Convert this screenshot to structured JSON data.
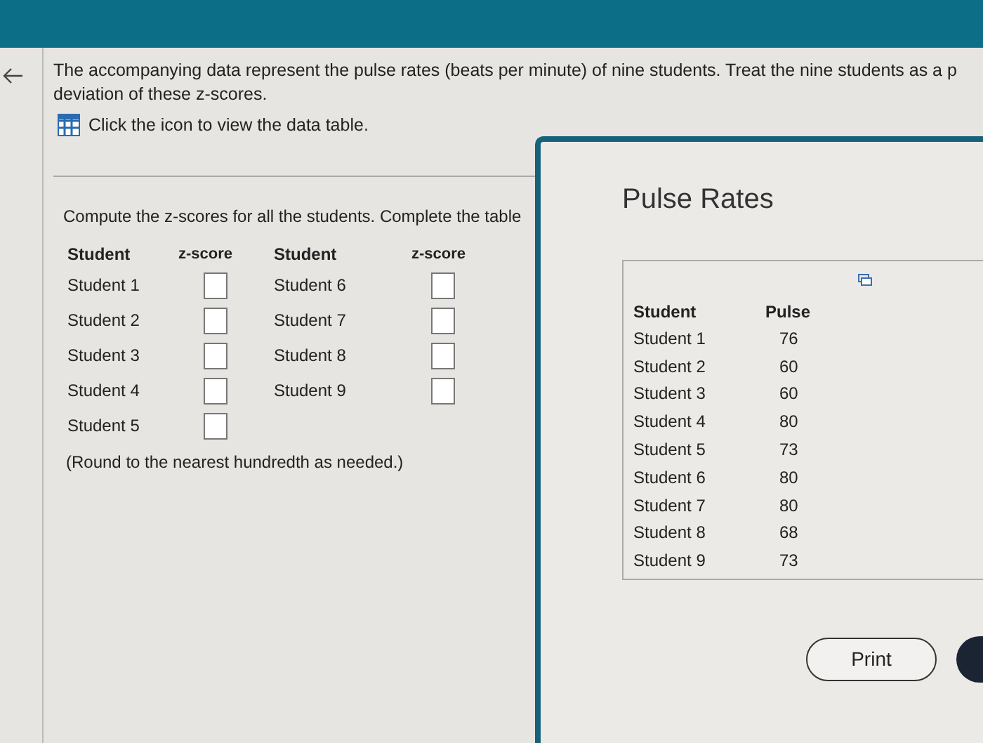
{
  "question": {
    "lines": [
      "The accompanying data represent the pulse rates (beats per minute) of nine students. Treat the nine students as a p",
      "deviation of these z-scores."
    ],
    "data_link": "Click the icon to view the data table."
  },
  "task": {
    "instruction": "Compute the z-scores for all the students. Complete the table",
    "headers": [
      "Student",
      "z-score",
      "Student",
      "z-score"
    ],
    "left_rows": [
      {
        "student": "Student 1",
        "answer": ""
      },
      {
        "student": "Student 2",
        "answer": ""
      },
      {
        "student": "Student 3",
        "answer": ""
      },
      {
        "student": "Student 4",
        "answer": ""
      },
      {
        "student": "Student 5",
        "answer": ""
      }
    ],
    "right_rows": [
      {
        "student": "Student 6",
        "answer": ""
      },
      {
        "student": "Student 7",
        "answer": ""
      },
      {
        "student": "Student 8",
        "answer": ""
      },
      {
        "student": "Student 9",
        "answer": ""
      }
    ],
    "note": "(Round to the nearest hundredth as needed.)"
  },
  "popup": {
    "title": "Pulse Rates",
    "columns": [
      "Student",
      "Pulse"
    ],
    "rows": [
      [
        "Student 1",
        "76"
      ],
      [
        "Student 2",
        "60"
      ],
      [
        "Student 3",
        "60"
      ],
      [
        "Student 4",
        "80"
      ],
      [
        "Student 5",
        "73"
      ],
      [
        "Student 6",
        "80"
      ],
      [
        "Student 7",
        "80"
      ],
      [
        "Student 8",
        "68"
      ],
      [
        "Student 9",
        "73"
      ]
    ],
    "buttons": [
      "Print"
    ]
  }
}
